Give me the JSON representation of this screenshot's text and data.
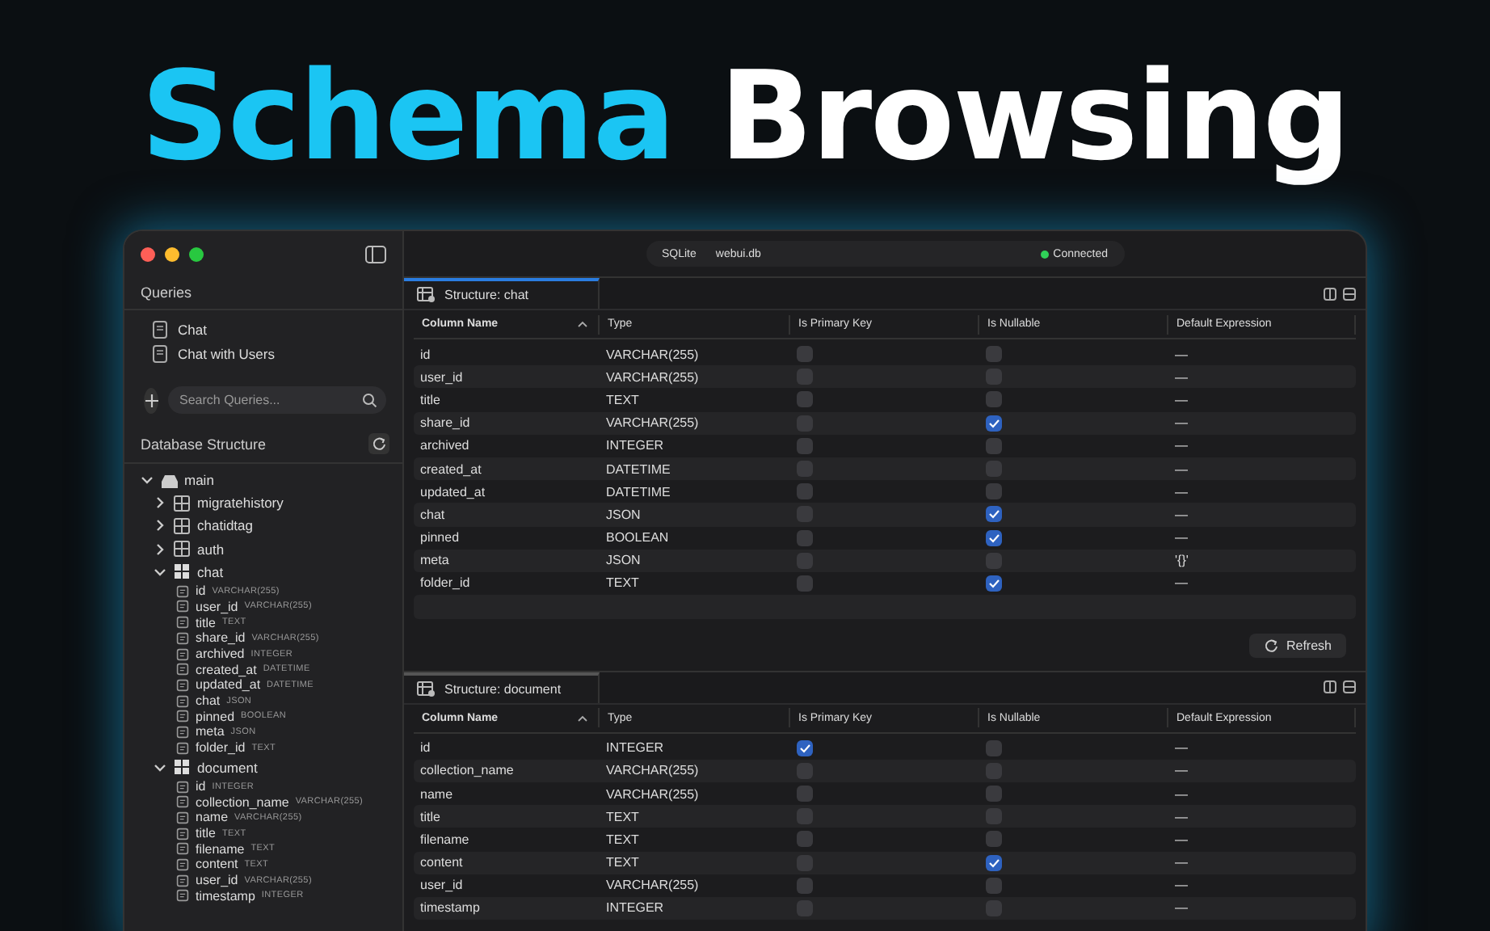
{
  "headline": [
    {
      "text": "Schema",
      "color": "#1bc5f3"
    },
    {
      "text": "Browsing",
      "color": "#ffffff"
    }
  ],
  "toolbar": {
    "engine": "SQLite",
    "database": "webui.db",
    "status": "Connected",
    "connected": true
  },
  "sidebar": {
    "queries_title": "Queries",
    "queries": [
      "Chat",
      "Chat with Users"
    ],
    "search": {
      "placeholder": "Search Queries..."
    },
    "structure_title": "Database Structure",
    "tree": [
      {
        "label": "main",
        "kind": "database",
        "expanded": true,
        "children": [
          {
            "label": "migratehistory",
            "kind": "table",
            "expanded": false
          },
          {
            "label": "chatidtag",
            "kind": "table",
            "expanded": false
          },
          {
            "label": "auth",
            "kind": "table",
            "expanded": false
          },
          {
            "label": "chat",
            "kind": "table",
            "expanded": true,
            "children": [
              {
                "label": "id",
                "kind": "column",
                "type": "VARCHAR(255)"
              },
              {
                "label": "user_id",
                "kind": "column",
                "type": "VARCHAR(255)"
              },
              {
                "label": "title",
                "kind": "column",
                "type": "TEXT"
              },
              {
                "label": "share_id",
                "kind": "column",
                "type": "VARCHAR(255)"
              },
              {
                "label": "archived",
                "kind": "column",
                "type": "INTEGER"
              },
              {
                "label": "created_at",
                "kind": "column",
                "type": "DATETIME"
              },
              {
                "label": "updated_at",
                "kind": "column",
                "type": "DATETIME"
              },
              {
                "label": "chat",
                "kind": "column",
                "type": "JSON"
              },
              {
                "label": "pinned",
                "kind": "column",
                "type": "BOOLEAN"
              },
              {
                "label": "meta",
                "kind": "column",
                "type": "JSON"
              },
              {
                "label": "folder_id",
                "kind": "column",
                "type": "TEXT"
              }
            ]
          },
          {
            "label": "document",
            "kind": "table",
            "expanded": true,
            "children": [
              {
                "label": "id",
                "kind": "column",
                "type": "INTEGER"
              },
              {
                "label": "collection_name",
                "kind": "column",
                "type": "VARCHAR(255)"
              },
              {
                "label": "name",
                "kind": "column",
                "type": "VARCHAR(255)"
              },
              {
                "label": "title",
                "kind": "column",
                "type": "TEXT"
              },
              {
                "label": "filename",
                "kind": "column",
                "type": "TEXT"
              },
              {
                "label": "content",
                "kind": "column",
                "type": "TEXT"
              },
              {
                "label": "user_id",
                "kind": "column",
                "type": "VARCHAR(255)"
              },
              {
                "label": "timestamp",
                "kind": "column",
                "type": "INTEGER"
              }
            ]
          }
        ]
      }
    ]
  },
  "panes": [
    {
      "tab": "Structure: chat",
      "selected": true,
      "columns": [
        "Column Name",
        "Type",
        "Is Primary Key",
        "Is Nullable",
        "Default Expression"
      ],
      "rows": [
        {
          "name": "id",
          "type": "VARCHAR(255)",
          "primary_key": false,
          "nullable": false,
          "default": "—"
        },
        {
          "name": "user_id",
          "type": "VARCHAR(255)",
          "primary_key": false,
          "nullable": false,
          "default": "—"
        },
        {
          "name": "title",
          "type": "TEXT",
          "primary_key": false,
          "nullable": false,
          "default": "—"
        },
        {
          "name": "share_id",
          "type": "VARCHAR(255)",
          "primary_key": false,
          "nullable": true,
          "default": "—"
        },
        {
          "name": "archived",
          "type": "INTEGER",
          "primary_key": false,
          "nullable": false,
          "default": "—"
        },
        {
          "name": "created_at",
          "type": "DATETIME",
          "primary_key": false,
          "nullable": false,
          "default": "—"
        },
        {
          "name": "updated_at",
          "type": "DATETIME",
          "primary_key": false,
          "nullable": false,
          "default": "—"
        },
        {
          "name": "chat",
          "type": "JSON",
          "primary_key": false,
          "nullable": true,
          "default": "—"
        },
        {
          "name": "pinned",
          "type": "BOOLEAN",
          "primary_key": false,
          "nullable": true,
          "default": "—"
        },
        {
          "name": "meta",
          "type": "JSON",
          "primary_key": false,
          "nullable": false,
          "default": "'{}'"
        },
        {
          "name": "folder_id",
          "type": "TEXT",
          "primary_key": false,
          "nullable": true,
          "default": "—"
        }
      ],
      "refresh_button": "Refresh"
    },
    {
      "tab": "Structure: document",
      "selected": false,
      "columns": [
        "Column Name",
        "Type",
        "Is Primary Key",
        "Is Nullable",
        "Default Expression"
      ],
      "rows": [
        {
          "name": "id",
          "type": "INTEGER",
          "primary_key": true,
          "nullable": false,
          "default": "—"
        },
        {
          "name": "collection_name",
          "type": "VARCHAR(255)",
          "primary_key": false,
          "nullable": false,
          "default": "—"
        },
        {
          "name": "name",
          "type": "VARCHAR(255)",
          "primary_key": false,
          "nullable": false,
          "default": "—"
        },
        {
          "name": "title",
          "type": "TEXT",
          "primary_key": false,
          "nullable": false,
          "default": "—"
        },
        {
          "name": "filename",
          "type": "TEXT",
          "primary_key": false,
          "nullable": false,
          "default": "—"
        },
        {
          "name": "content",
          "type": "TEXT",
          "primary_key": false,
          "nullable": true,
          "default": "—"
        },
        {
          "name": "user_id",
          "type": "VARCHAR(255)",
          "primary_key": false,
          "nullable": false,
          "default": "—"
        },
        {
          "name": "timestamp",
          "type": "INTEGER",
          "primary_key": false,
          "nullable": false,
          "default": "—"
        }
      ]
    }
  ]
}
